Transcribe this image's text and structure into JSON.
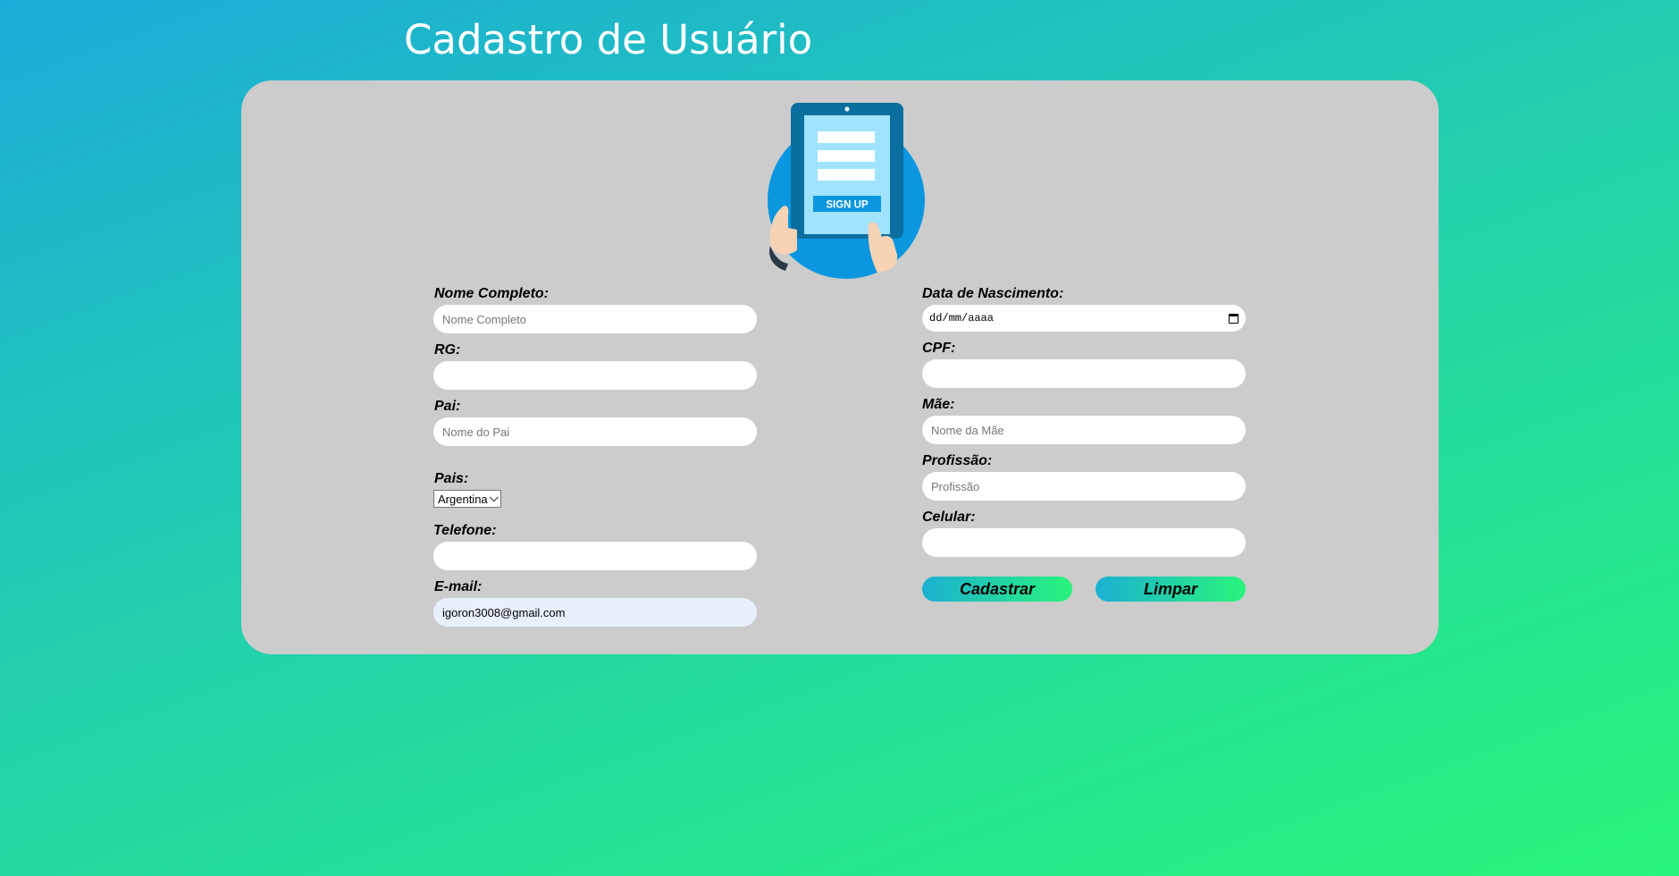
{
  "page": {
    "title": "Cadastro de Usuário"
  },
  "illustration": {
    "icon": "tablet-sign-up-illustration",
    "button_text": "SIGN UP"
  },
  "form": {
    "left": {
      "nome_completo": {
        "label": "Nome Completo:",
        "placeholder": "Nome Completo",
        "value": ""
      },
      "rg": {
        "label": "RG:",
        "placeholder": "",
        "value": ""
      },
      "pai": {
        "label": "Pai:",
        "placeholder": "Nome do Pai",
        "value": ""
      },
      "pais": {
        "label": "Pais:",
        "selected": "Argentina"
      },
      "telefone": {
        "label": "Telefone:",
        "placeholder": "",
        "value": ""
      },
      "email": {
        "label": "E-mail:",
        "placeholder": "",
        "value": "igoron3008@gmail.com"
      }
    },
    "right": {
      "data_nascimento": {
        "label": "Data de Nascimento:",
        "placeholder": "dd/mm/aaaa"
      },
      "cpf": {
        "label": "CPF:",
        "placeholder": "",
        "value": ""
      },
      "mae": {
        "label": "Mãe:",
        "placeholder": "Nome da Mãe",
        "value": ""
      },
      "profissao": {
        "label": "Profissão:",
        "placeholder": "Profissão",
        "value": ""
      },
      "celular": {
        "label": "Celular:",
        "placeholder": "",
        "value": ""
      }
    },
    "buttons": {
      "submit": "Cadastrar",
      "clear": "Limpar"
    }
  },
  "colors": {
    "bg_start": "#1cabd8",
    "bg_end": "#29f47a",
    "card": "#cccccc",
    "illustration_circle": "#0b96e0",
    "tablet_frame": "#0a6f9f",
    "tablet_screen": "#9fe3ff",
    "sign_up_button": "#0b96e0"
  }
}
